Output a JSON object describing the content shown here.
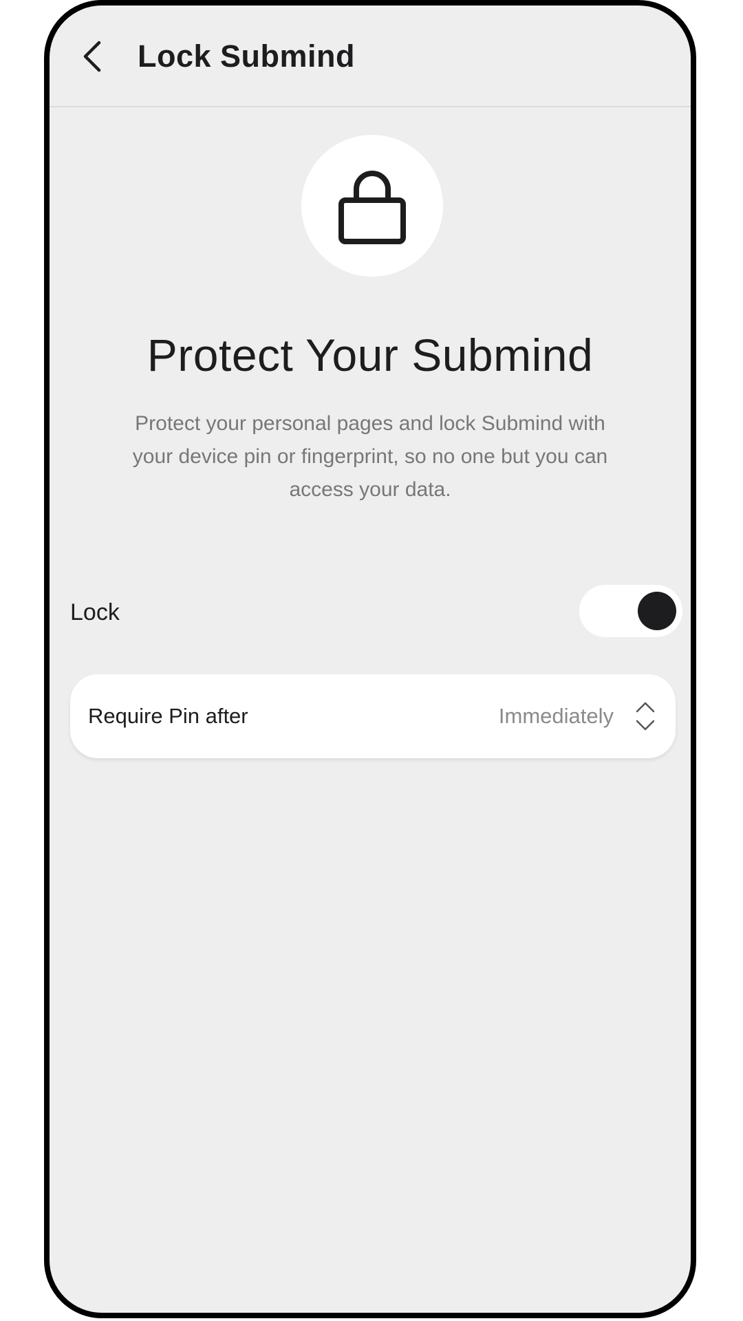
{
  "header": {
    "title": "Lock Submind",
    "back_icon": "chevron-left-icon"
  },
  "hero": {
    "icon": "lock-icon",
    "headline": "Protect Your Submind",
    "description": "Protect your personal pages and lock Submind with\nyour device pin or fingerprint, so no  one but you can\naccess your data."
  },
  "lock_setting": {
    "label": "Lock",
    "enabled": true
  },
  "pin_setting": {
    "label": "Require Pin after",
    "value": "Immediately",
    "icon": "chevron-up-down-icon"
  },
  "colors": {
    "background": "#eeeeee",
    "surface": "#ffffff",
    "text_primary": "#1d1d1f",
    "text_secondary": "#777777",
    "toggle_knob": "#1d1d1f"
  }
}
